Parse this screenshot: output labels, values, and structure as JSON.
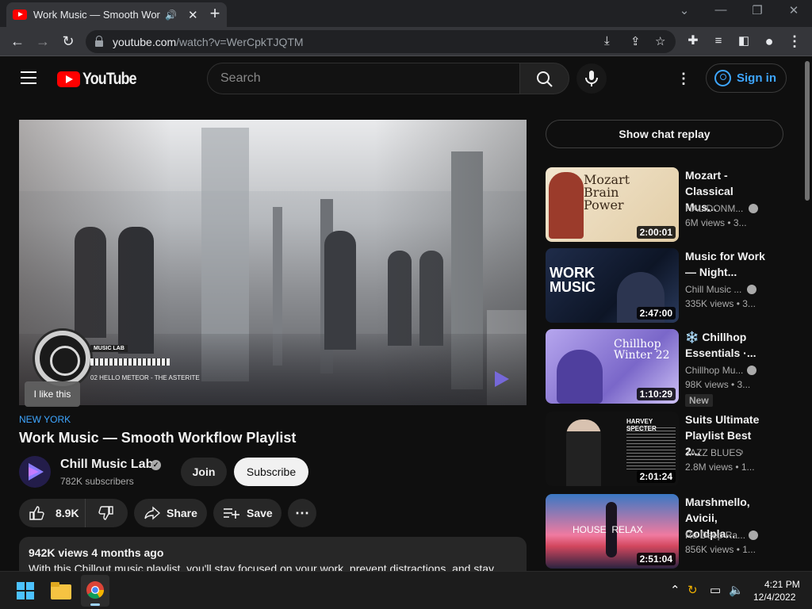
{
  "browser": {
    "tab_title": "Work Music — Smooth Workflow Playlist",
    "url_host": "youtube.com",
    "url_path": "/watch?v=WerCpkTJQTM"
  },
  "header": {
    "logo_text": "YouTube",
    "search_placeholder": "Search",
    "signin_label": "Sign in"
  },
  "player": {
    "overlay_tag": "MUSIC LAB",
    "track_label": "02  HELLO METEOR - THE ASTERITE",
    "tooltip": "I like this"
  },
  "video": {
    "hashtag": "NEW YORK",
    "title": "Work Music — Smooth Workflow Playlist",
    "channel_name": "Chill Music Lab",
    "subscribers": "782K subscribers",
    "join_label": "Join",
    "subscribe_label": "Subscribe",
    "like_count": "8.9K",
    "share_label": "Share",
    "save_label": "Save",
    "description_meta": "942K views  4 months ago",
    "description_text": "With this Chillout music playlist, you'll stay focused on your work, prevent distractions, and stay"
  },
  "sidebar": {
    "chat_replay_label": "Show chat replay",
    "recommendations": [
      {
        "title": "Mozart - Classical Mus...",
        "channel": "HALIDONM...",
        "views": "6M views  • 3...",
        "duration": "2:00:01",
        "thumb_text": "Mozart Brain Power"
      },
      {
        "title": "Music for Work — Night...",
        "channel": "Chill Music ...",
        "views": "335K views  • 3...",
        "duration": "2:47:00",
        "thumb_text": "WORK MUSIC"
      },
      {
        "title": "❄️ Chillhop Essentials ·...",
        "channel": "Chillhop Mu...",
        "views": "98K views  • 3...",
        "duration": "1:10:29",
        "thumb_text": "Chillhop Winter 22",
        "badge": "New"
      },
      {
        "title": "Suits Ultimate Playlist Best 2...",
        "channel": "JAZZ BLUES",
        "views": "2.8M views  • 1...",
        "duration": "2:01:24",
        "thumb_text": "HARVEY SPECTER"
      },
      {
        "title": "Marshmello, Avicii, Coldpla...",
        "channel": "Ru Deep Ra...",
        "views": "856K views  • 1...",
        "duration": "2:51:04",
        "thumb_text": "HOUSE  RELAX"
      }
    ]
  },
  "taskbar": {
    "time": "4:21 PM",
    "date": "12/4/2022"
  }
}
